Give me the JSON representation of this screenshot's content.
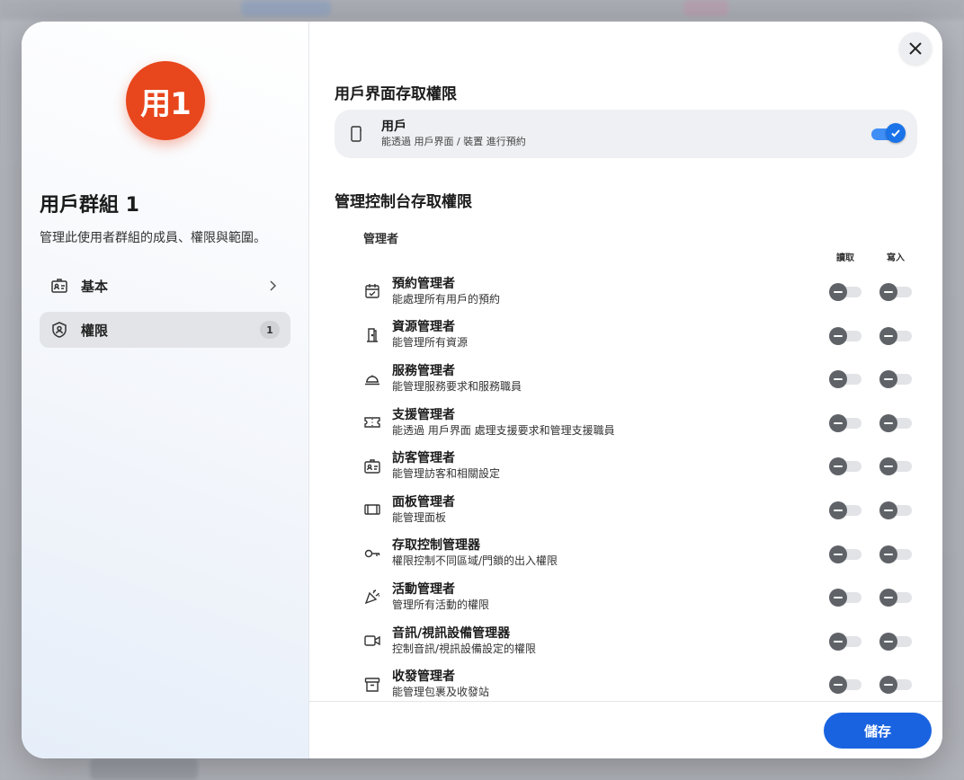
{
  "background": {},
  "sidebar": {
    "avatar_text": "用1",
    "group_title": "用戶群組 1",
    "group_desc": "管理此使用者群組的成員、權限與範圍。",
    "items": [
      {
        "label": "基本",
        "icon": "id-card-icon"
      },
      {
        "label": "權限",
        "icon": "shield-icon",
        "badge": "1"
      }
    ]
  },
  "main": {
    "section1_title": "用戶界面存取權限",
    "user_access": {
      "title": "用戶",
      "desc": "能透過 用戶界面 / 裝置 進行預約",
      "enabled": true
    },
    "section2_title": "管理控制台存取權限",
    "admin_subheading": "管理者",
    "col_read": "讀取",
    "col_write": "寫入",
    "roles": [
      {
        "title": "預約管理者",
        "desc": "能處理所有用戶的預約",
        "icon": "calendar-check-icon"
      },
      {
        "title": "資源管理者",
        "desc": "能管理所有資源",
        "icon": "door-icon"
      },
      {
        "title": "服務管理者",
        "desc": "能管理服務要求和服務職員",
        "icon": "service-bell-icon"
      },
      {
        "title": "支援管理者",
        "desc": "能透過 用戶界面 處理支援要求和管理支援職員",
        "icon": "ticket-icon"
      },
      {
        "title": "訪客管理者",
        "desc": "能管理訪客和相關設定",
        "icon": "visitor-badge-icon"
      },
      {
        "title": "面板管理者",
        "desc": "能管理面板",
        "icon": "panel-icon"
      },
      {
        "title": "存取控制管理器",
        "desc": "權限控制不同區域/門鎖的出入權限",
        "icon": "key-icon"
      },
      {
        "title": "活動管理者",
        "desc": "管理所有活動的權限",
        "icon": "party-popper-icon"
      },
      {
        "title": "音訊/視訊設備管理器",
        "desc": "控制音訊/視訊設備設定的權限",
        "icon": "video-camera-icon"
      },
      {
        "title": "收發管理者",
        "desc": "能管理包裹及收發站",
        "icon": "archive-box-icon"
      }
    ]
  },
  "footer": {
    "save_label": "儲存"
  },
  "colors": {
    "accent": "#1a63e0",
    "avatar": "#e8461c",
    "toggle_on": "#1a73e8",
    "toggle_off_knob": "#5f6368"
  }
}
